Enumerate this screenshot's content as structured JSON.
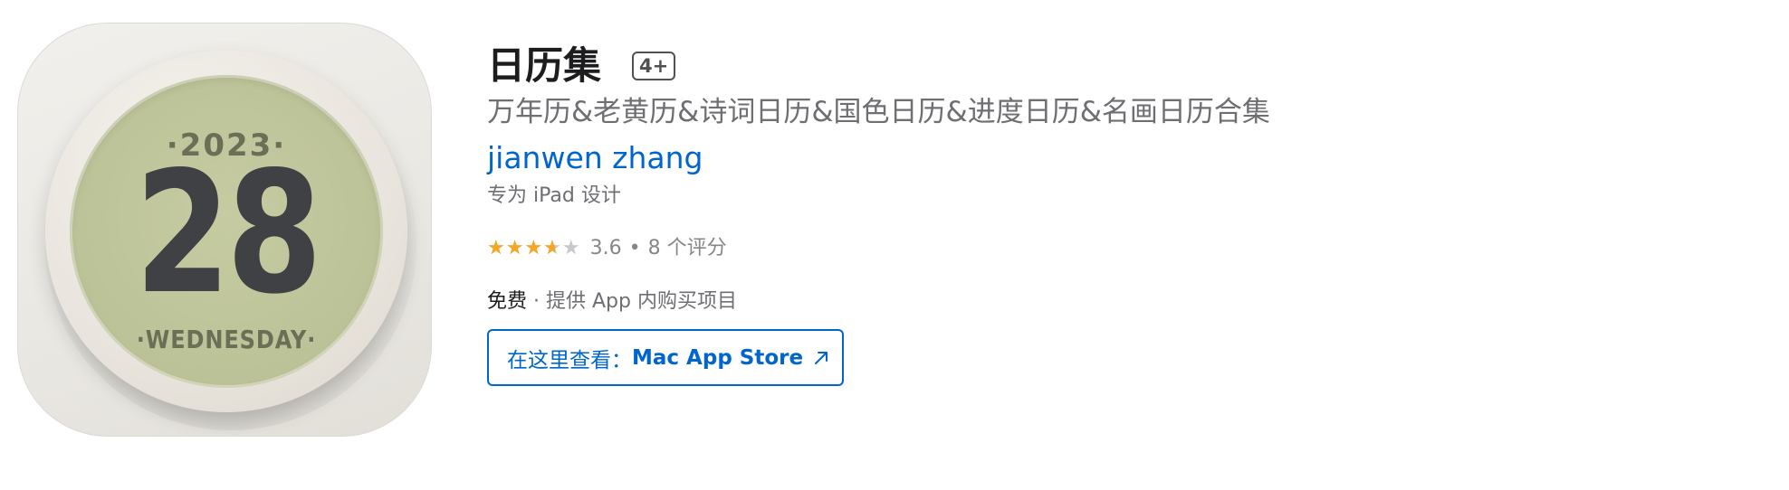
{
  "icon": {
    "year": "·2023·",
    "day": "28",
    "weekday": "·WEDNESDAY·",
    "colors": {
      "face": "#bcc297",
      "digits": "#3f4144",
      "labels": "#6b6f56"
    }
  },
  "app": {
    "title": "日历集",
    "age_rating": "4+",
    "subtitle": "万年历&老黄历&诗词日历&国色日历&进度日历&名画日历合集",
    "developer": "jianwen zhang",
    "designed_for": "专为 iPad 设计"
  },
  "rating": {
    "stars": "★★★★★",
    "value": 3.6,
    "value_text": "3.6",
    "separator": "•",
    "count_text": "8 个评分"
  },
  "price": {
    "label": "免费",
    "separator": " · ",
    "iap_text": "提供 App 内购买项目"
  },
  "mac_button": {
    "prefix": "在这里查看：",
    "store": "Mac App Store",
    "icon": "arrow-up-right-icon"
  },
  "colors": {
    "link": "#0066cc",
    "star": "#f5a623",
    "text_primary": "#1d1d1f",
    "text_secondary": "#6e6e73"
  }
}
